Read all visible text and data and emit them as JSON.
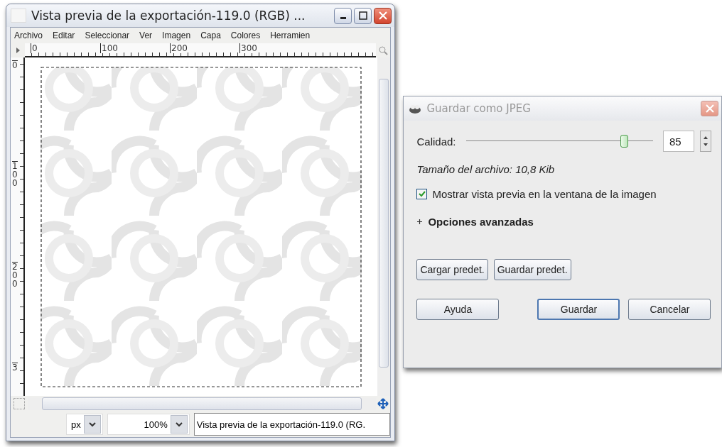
{
  "image_window": {
    "title": "Vista previa de la exportación-119.0 (RGB) ...",
    "menu": [
      "Archivo",
      "Editar",
      "Seleccionar",
      "Ver",
      "Imagen",
      "Capa",
      "Colores",
      "Herramien"
    ],
    "ruler_h": [
      "0",
      "100",
      "200",
      "300"
    ],
    "ruler_v": [
      "0",
      "100",
      "200",
      "3"
    ],
    "unit": "px",
    "zoom": "100%",
    "status": "Vista previa de la exportación-119.0 (RG."
  },
  "dialog": {
    "title": "Guardar como JPEG",
    "quality": {
      "label": "Calidad:",
      "level": 0.85,
      "value": "85"
    },
    "file_size": "Tamaño del archivo: 10,8 Kib",
    "preview": {
      "label": "Mostrar vista previa en la ventana de la imagen",
      "checked": true
    },
    "advanced": {
      "label": "Opciones avanzadas",
      "expanded": false
    },
    "preset_buttons": [
      "Cargar predet.",
      "Guardar predet."
    ],
    "buttons": [
      {
        "label": "Ayuda",
        "default": false
      },
      {
        "label": "Guardar",
        "default": true
      },
      {
        "label": "Cancelar",
        "default": false
      }
    ]
  }
}
